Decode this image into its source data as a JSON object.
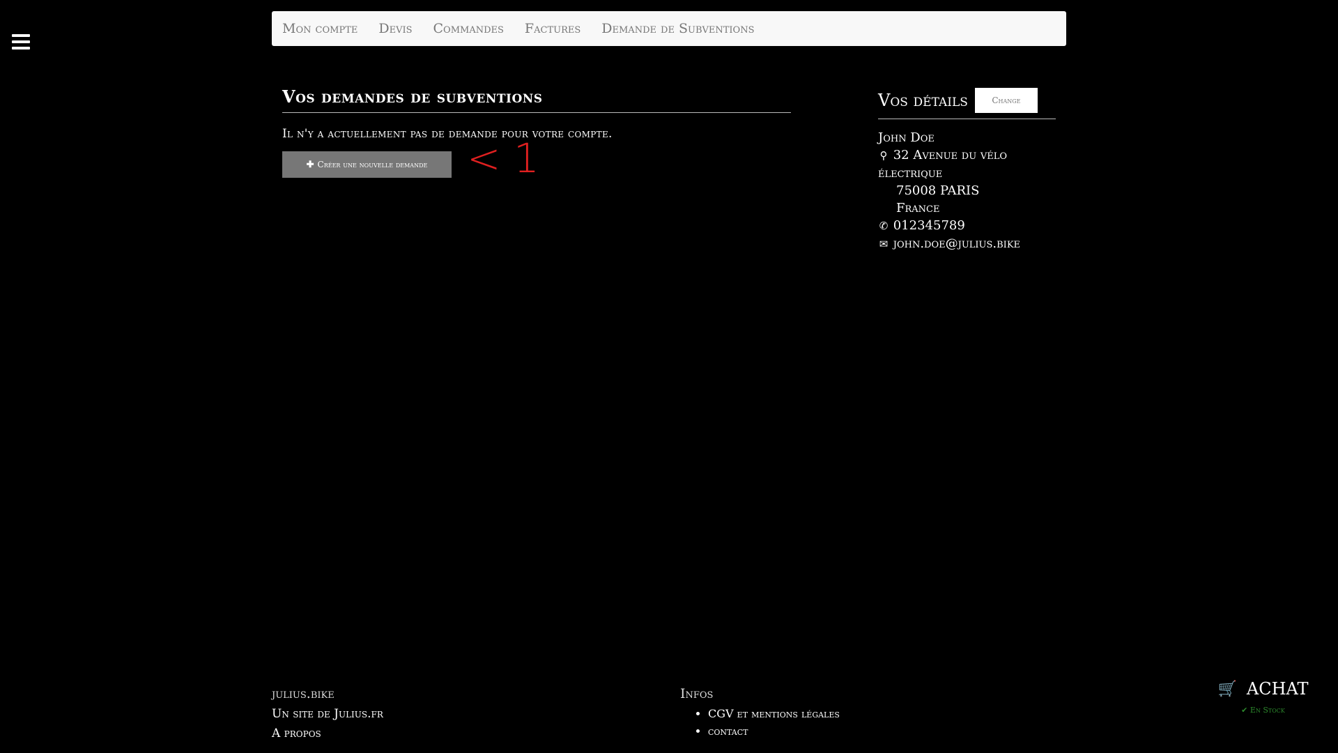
{
  "nav": {
    "items": [
      "Mon compte",
      "Devis",
      "Commandes",
      "Factures",
      "Demande de Subventions"
    ]
  },
  "main": {
    "title": "Vos demandes de subventions",
    "empty_message": "Il n'y a actuellement pas de demande pour votre compte.",
    "create_button_label": "Créer une nouvelle demande",
    "annotation": "< 1"
  },
  "details": {
    "title": "Vos détails",
    "change_label": "Change",
    "name": "John Doe",
    "address_line1": "32 Avenue du vélo électrique",
    "address_line2": "75008 PARIS",
    "country": "France",
    "phone": "012345789",
    "email": "john.doe@julius.bike"
  },
  "footer": {
    "brand": "julius.bike",
    "site_link": "Un site de Julius.fr",
    "about_link": "A propos",
    "infos_title": "Infos",
    "infos_items": [
      "CGV et mentions légales",
      "contact"
    ]
  },
  "cart": {
    "label": "ACHAT",
    "stock": "En Stock"
  },
  "colors": {
    "annotation": "#e02020",
    "stock": "#2d8a2d",
    "nav_bg": "#f8f8f8"
  }
}
